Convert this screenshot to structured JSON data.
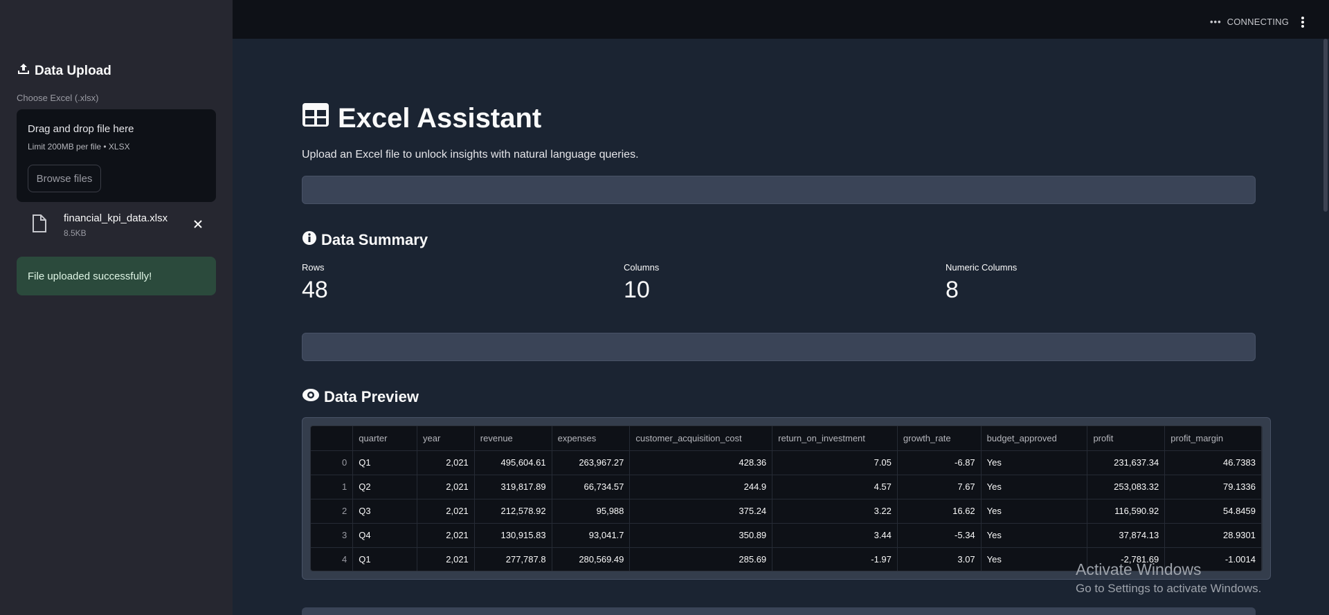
{
  "sidebar": {
    "title": "Data Upload",
    "upload_label": "Choose Excel (.xlsx)",
    "dropzone_text": "Drag and drop file here",
    "dropzone_limit": "Limit 200MB per file • XLSX",
    "browse_label": "Browse files",
    "file": {
      "name": "financial_kpi_data.xlsx",
      "size": "8.5KB"
    },
    "success_message": "File uploaded successfully!"
  },
  "header": {
    "status": "CONNECTING"
  },
  "main": {
    "title": "Excel Assistant",
    "subtitle": "Upload an Excel file to unlock insights with natural language queries.",
    "summary": {
      "title": "Data Summary",
      "metrics": [
        {
          "label": "Rows",
          "value": "48"
        },
        {
          "label": "Columns",
          "value": "10"
        },
        {
          "label": "Numeric Columns",
          "value": "8"
        }
      ]
    },
    "preview": {
      "title": "Data Preview",
      "columns": [
        "",
        "quarter",
        "year",
        "revenue",
        "expenses",
        "customer_acquisition_cost",
        "return_on_investment",
        "growth_rate",
        "budget_approved",
        "profit",
        "profit_margin"
      ],
      "rows": [
        [
          "0",
          "Q1",
          "2,021",
          "495,604.61",
          "263,967.27",
          "428.36",
          "7.05",
          "-6.87",
          "Yes",
          "231,637.34",
          "46.7383"
        ],
        [
          "1",
          "Q2",
          "2,021",
          "319,817.89",
          "66,734.57",
          "244.9",
          "4.57",
          "7.67",
          "Yes",
          "253,083.32",
          "79.1336"
        ],
        [
          "2",
          "Q3",
          "2,021",
          "212,578.92",
          "95,988",
          "375.24",
          "3.22",
          "16.62",
          "Yes",
          "116,590.92",
          "54.8459"
        ],
        [
          "3",
          "Q4",
          "2,021",
          "130,915.83",
          "93,041.7",
          "350.89",
          "3.44",
          "-5.34",
          "Yes",
          "37,874.13",
          "28.9301"
        ],
        [
          "4",
          "Q1",
          "2,021",
          "277,787.8",
          "280,569.49",
          "285.69",
          "-1.97",
          "3.07",
          "Yes",
          "-2,781.69",
          "-1.0014"
        ]
      ]
    }
  },
  "watermark": {
    "line1": "Activate Windows",
    "line2": "Go to Settings to activate Windows."
  }
}
